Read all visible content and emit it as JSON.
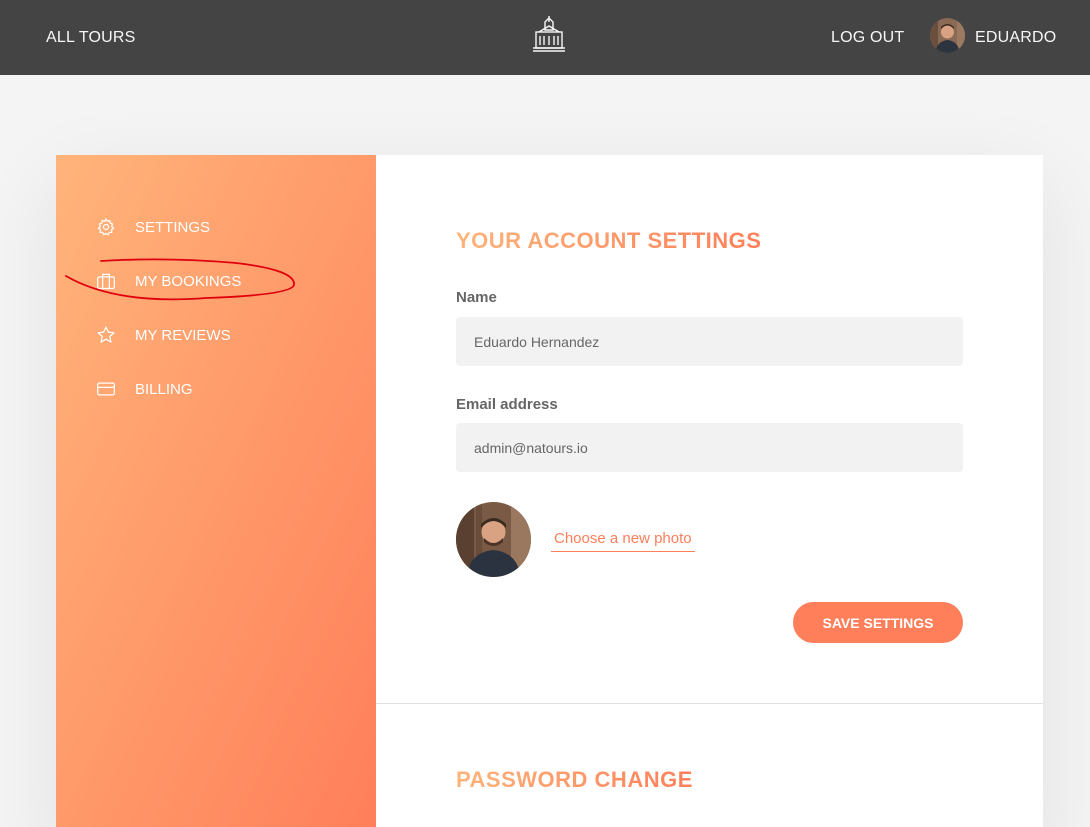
{
  "header": {
    "all_tours": "ALL TOURS",
    "logout": "LOG OUT",
    "user_name": "EDUARDO",
    "logo_icon": "natours-logo-icon",
    "avatar_icon": "user-avatar"
  },
  "sidebar": {
    "items": [
      {
        "label": "SETTINGS",
        "icon": "gear-icon"
      },
      {
        "label": "MY BOOKINGS",
        "icon": "briefcase-icon"
      },
      {
        "label": "MY REVIEWS",
        "icon": "star-icon"
      },
      {
        "label": "BILLING",
        "icon": "credit-card-icon"
      }
    ],
    "gradient": [
      "#ffb47a",
      "#ff7f5a"
    ]
  },
  "settings": {
    "title": "YOUR ACCOUNT SETTINGS",
    "name_label": "Name",
    "name_value": "Eduardo Hernandez",
    "email_label": "Email address",
    "email_value": "admin@natours.io",
    "photo_link": "Choose a new photo",
    "save_label": "SAVE SETTINGS"
  },
  "password": {
    "title": "PASSWORD CHANGE"
  },
  "colors": {
    "header_bg": "#444444",
    "accent": "#ff7f5a",
    "annotation": "#e0000d"
  }
}
